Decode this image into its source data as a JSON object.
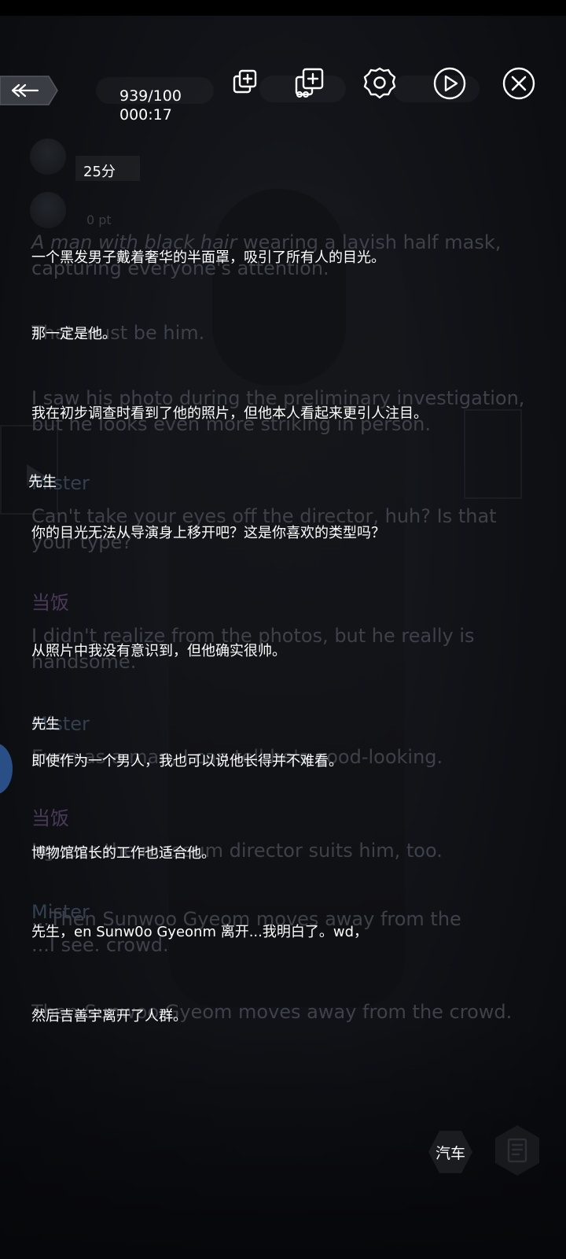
{
  "top_bar": {
    "back_icon": "back-arrow-icon",
    "progress": "939/100",
    "timer": "000:17",
    "icons": [
      "copy-icon",
      "add-copy-icon",
      "settings-gear-icon",
      "play-icon",
      "close-icon"
    ]
  },
  "score": {
    "points": "25分",
    "pt_label": "0 pt"
  },
  "ghost_lines": {
    "l1a_italic": "A man with black hair",
    "l1a_rest": " wearing a lavish half mask,",
    "l1b": "capturing everyone's attention.",
    "l2": "That must be him.",
    "l3a": "I saw his photo during the preliminary investigation,",
    "l3b": "but he looks even more striking in person.",
    "n1": "Mister",
    "l4a": "Can't take your eyes off the director, huh? Is that",
    "l4b": "your type?",
    "n2": "当饭",
    "l5a": "I didn't realize from the photos, but he really is",
    "l5b": "handsome.",
    "n3": "Mister",
    "l6": "Even as a man, I can tell he's good-looking.",
    "n4": "当饭",
    "l7": "I guess the museum director suits him, too.",
    "n5": "Mister",
    "l8a": "...Then Sunwoo Gyeom moves away from the",
    "l8b": "...I see. crowd.",
    "l9": "Then Sunwoo Gyeom moves away from the crowd."
  },
  "translations": {
    "t1": "一个黑发男子戴着奢华的半面罩，吸引了所有人的目光。",
    "t2": "那一定是他。",
    "t3": "我在初步调查时看到了他的照片，但他本人看起来更引人注目。",
    "n1": "先生",
    "t4": "你的目光无法从导演身上移开吧？这是你喜欢的类型吗？",
    "t5": "从照片中我没有意识到，但他确实很帅。",
    "n2": "先生",
    "t6": "即使作为一个男人，我也可以说他长得并不难看。",
    "t7": "博物馆馆长的工作也适合他。",
    "t8": "先生，en Sunw0o Gyeonm 离开...我明白了。wd，",
    "t9": "然后吉善宇离开了人群。"
  },
  "bottom": {
    "car_label": "汽车",
    "log_icon": "log-book-icon"
  }
}
